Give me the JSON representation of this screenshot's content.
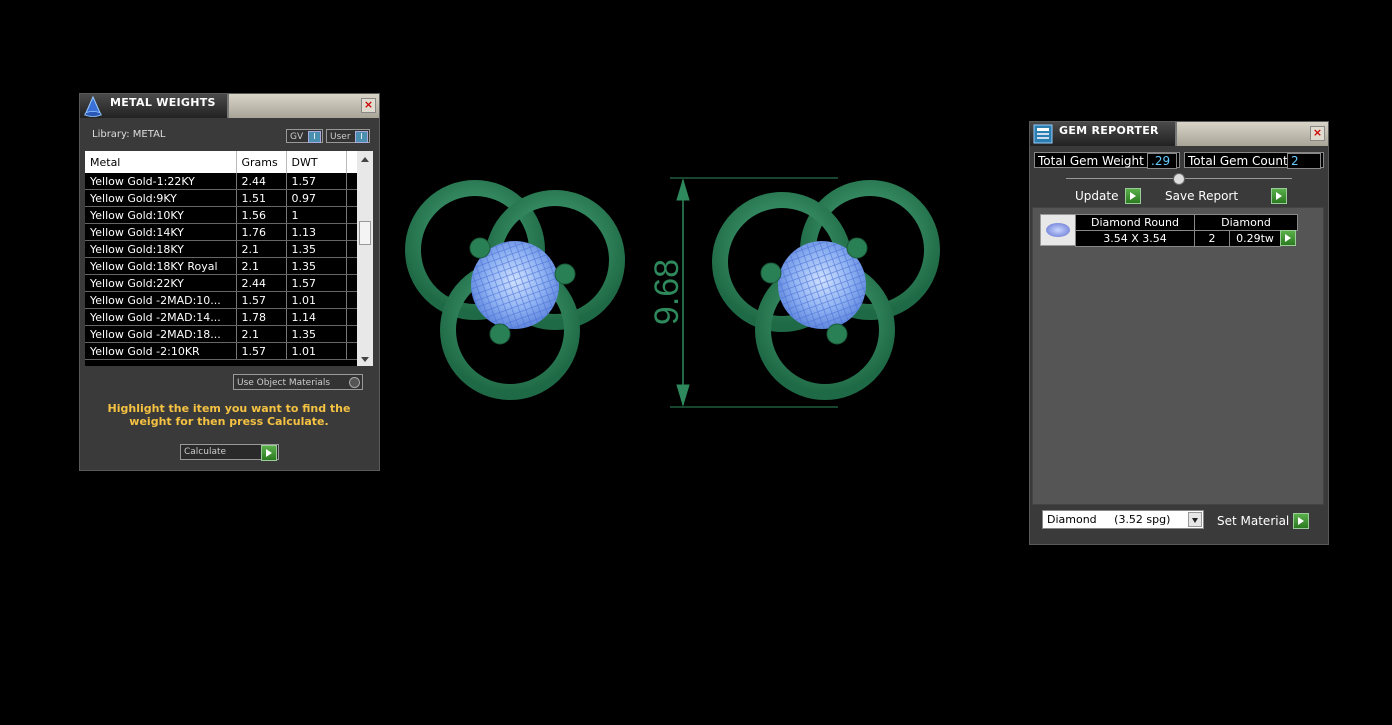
{
  "metal_weights": {
    "title": "METAL WEIGHTS",
    "library_label": "Library: METAL",
    "gv_label": "GV",
    "user_label": "User",
    "columns": [
      "Metal",
      "Grams",
      "DWT"
    ],
    "rows": [
      [
        "Yellow Gold-1:22KY",
        "2.44",
        "1.57"
      ],
      [
        "Yellow Gold:9KY",
        "1.51",
        "0.97"
      ],
      [
        "Yellow Gold:10KY",
        "1.56",
        "1"
      ],
      [
        "Yellow Gold:14KY",
        "1.76",
        "1.13"
      ],
      [
        "Yellow Gold:18KY",
        "2.1",
        "1.35"
      ],
      [
        "Yellow Gold:18KY Royal",
        "2.1",
        "1.35"
      ],
      [
        "Yellow Gold:22KY",
        "2.44",
        "1.57"
      ],
      [
        "Yellow Gold -2MAD:10...",
        "1.57",
        "1.01"
      ],
      [
        "Yellow Gold -2MAD:14...",
        "1.78",
        "1.14"
      ],
      [
        "Yellow Gold -2MAD:18...",
        "2.1",
        "1.35"
      ],
      [
        "Yellow Gold -2:10KR",
        "1.57",
        "1.01"
      ]
    ],
    "use_object_materials": "Use Object Materials",
    "hint": "Highlight the item you want to find the weight for then press Calculate.",
    "calculate_label": "Calculate"
  },
  "viewport": {
    "dimension_label": "9.68",
    "metal_color": "#2f8a5e",
    "gem_color": "#7fa8f0"
  },
  "gem_reporter": {
    "title": "GEM REPORTER",
    "total_weight_label": "Total Gem Weight",
    "total_weight_value": ".29",
    "total_count_label": "Total Gem Count",
    "total_count_value": "2",
    "update_label": "Update",
    "save_report_label": "Save Report",
    "gem_shape": "Diamond Round",
    "gem_material": "Diamond",
    "gem_size": "3.54 X 3.54",
    "gem_count": "2",
    "gem_weight": "0.29tw",
    "material_select": "Diamond     (3.52 spg)",
    "set_material_label": "Set Material"
  }
}
